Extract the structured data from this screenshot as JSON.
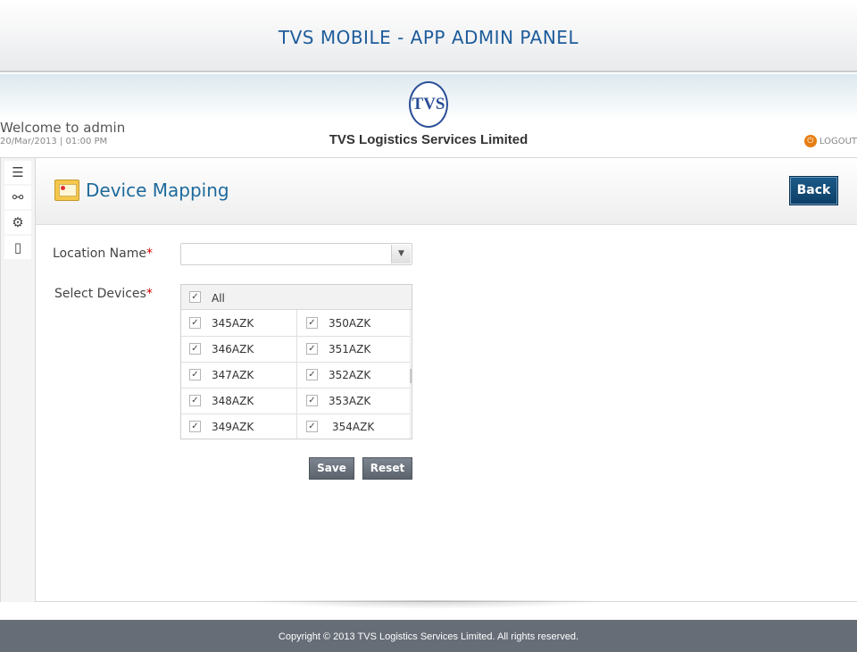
{
  "header": {
    "app_title": "TVS MOBILE - APP ADMIN PANEL"
  },
  "user_bar": {
    "welcome": "Welcome to admin",
    "datetime": "20/Mar/2013 | 01:00 PM",
    "logo_text": "TVS",
    "company": "TVS Logistics Services Limited",
    "logout_label": "LOGOUT"
  },
  "sidebar": {
    "items": [
      {
        "icon": "list-icon",
        "glyph": "☰"
      },
      {
        "icon": "link-icon",
        "glyph": "⚯"
      },
      {
        "icon": "gear-icon",
        "glyph": "⚙"
      },
      {
        "icon": "document-icon",
        "glyph": "▯"
      }
    ]
  },
  "page": {
    "title": "Device Mapping",
    "back_label": "Back",
    "location_label": "Location Name",
    "location_value": "",
    "devices_label": "Select Devices",
    "required_mark": "*",
    "all_label": "All",
    "all_checked": true,
    "devices": [
      [
        "345AZK",
        "350AZK"
      ],
      [
        "346AZK",
        "351AZK"
      ],
      [
        "347AZK",
        "352AZK"
      ],
      [
        "348AZK",
        "353AZK"
      ],
      [
        "349AZK",
        "354AZK"
      ]
    ],
    "check_mark": "✓",
    "save_label": "Save",
    "reset_label": "Reset"
  },
  "footer": {
    "copyright": "Copyright © 2013 TVS Logistics Services Limited. All rights reserved."
  },
  "colors": {
    "accent": "#1e6a9c",
    "back_button": "#0c3e65",
    "footer_bg": "#666d77",
    "logout_icon": "#e67d12"
  }
}
